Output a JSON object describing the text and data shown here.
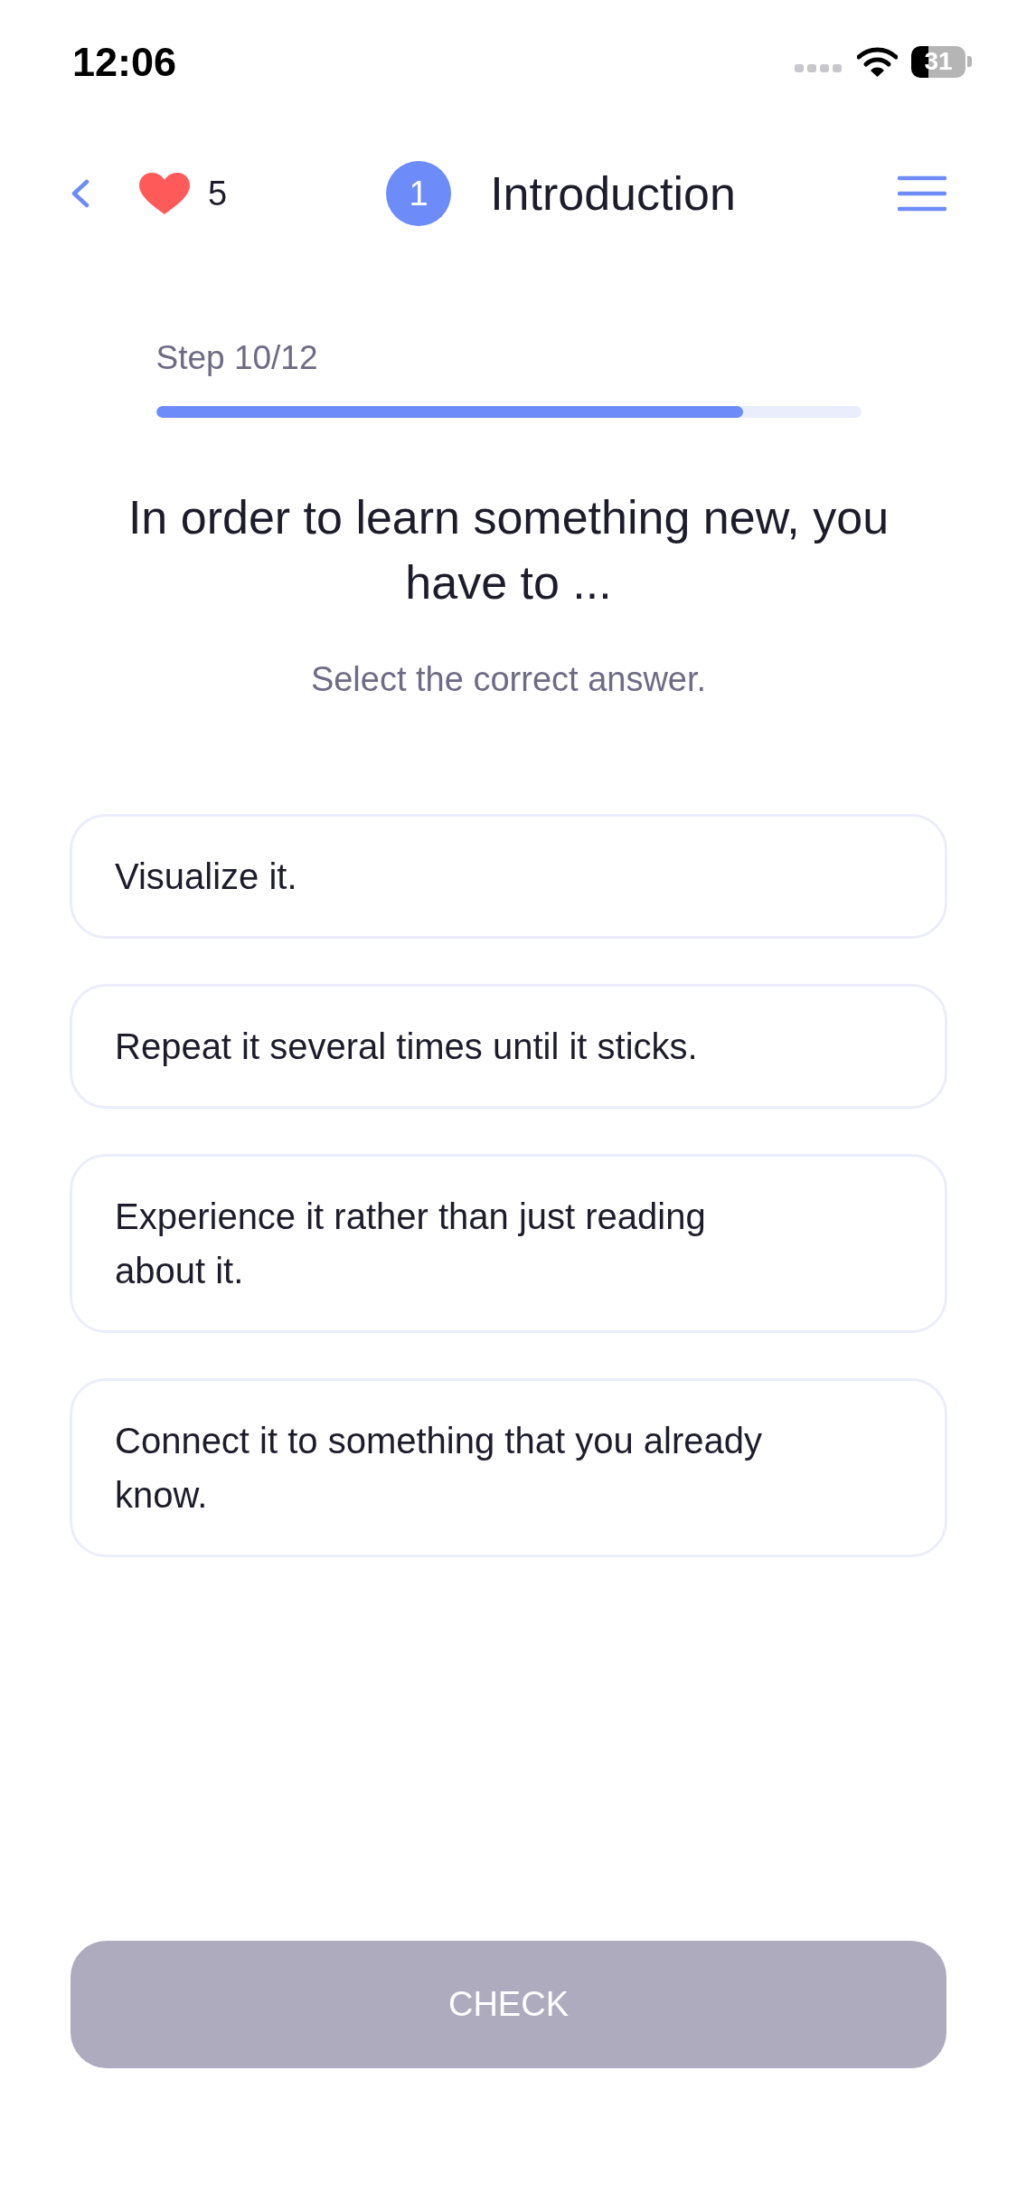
{
  "status_bar": {
    "time": "12:06",
    "battery": "31"
  },
  "header": {
    "lives": "5",
    "lesson_number": "1",
    "lesson_title": "Introduction"
  },
  "progress": {
    "label": "Step 10/12",
    "level": 0.833
  },
  "question": {
    "prompt": "In order to learn something new, you have to ...",
    "instruction": "Select the correct answer."
  },
  "answers": [
    {
      "text": "Visualize it.",
      "selected": false
    },
    {
      "text": "Repeat it several times until it sticks.",
      "selected": false
    },
    {
      "text": "Experience it rather than just reading about it.",
      "selected": false
    },
    {
      "text": "Connect it to something that you already know.",
      "selected": false
    }
  ],
  "check_button": {
    "label": "CHECK",
    "disabled": true
  }
}
